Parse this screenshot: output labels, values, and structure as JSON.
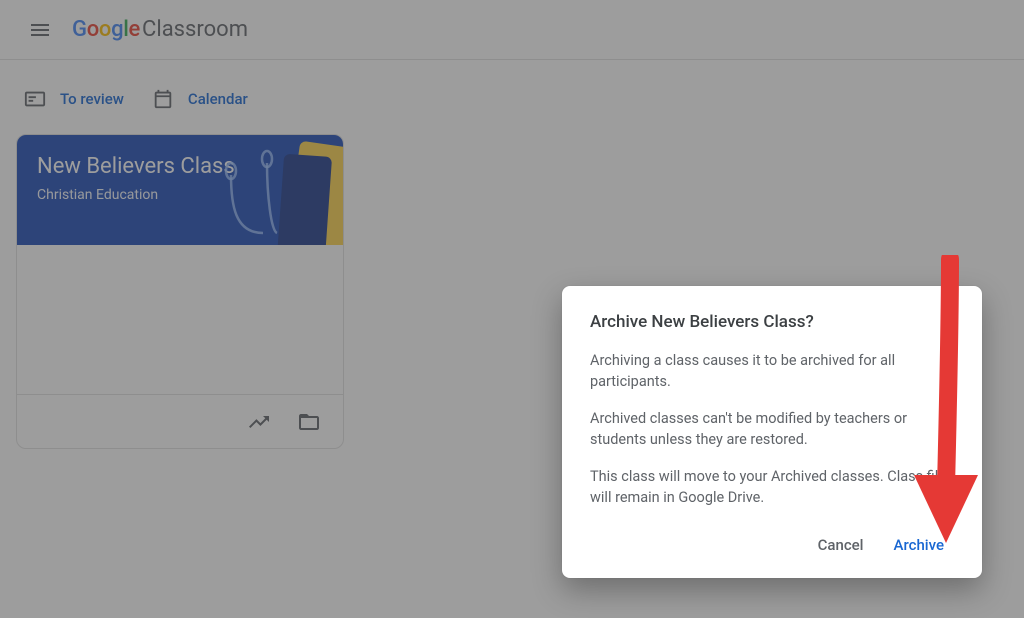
{
  "header": {
    "brand_google": "Google",
    "brand_classroom": "Classroom"
  },
  "subnav": {
    "review": "To review",
    "calendar": "Calendar"
  },
  "class_card": {
    "title": "New Believers Class",
    "section": "Christian Education"
  },
  "dialog": {
    "title": "Archive New Believers Class?",
    "p1": "Archiving a class causes it to be archived for all participants.",
    "p2": "Archived classes can't be modified by teachers or students unless they are restored.",
    "p3": "This class will move to your Archived classes. Class files will remain in Google Drive.",
    "cancel": "Cancel",
    "archive": "Archive"
  }
}
